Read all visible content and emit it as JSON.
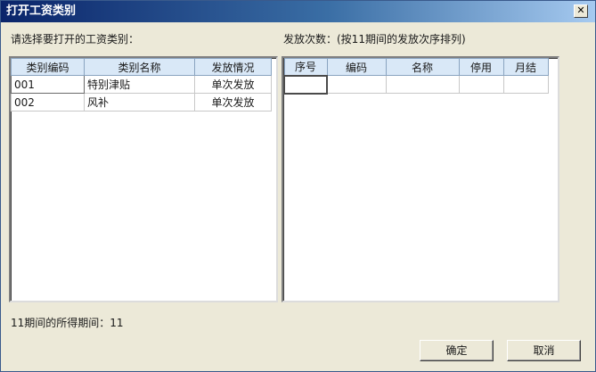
{
  "window": {
    "title": "打开工资类别",
    "close_glyph": "✕"
  },
  "left": {
    "label": "请选择要打开的工资类别：",
    "columns": [
      "类别编码",
      "类别名称",
      "发放情况"
    ],
    "rows": [
      [
        "001",
        "特别津贴",
        "单次发放"
      ],
      [
        "002",
        "风补",
        "单次发放"
      ]
    ]
  },
  "right": {
    "label": "发放次数：(按11期间的发放次序排列)",
    "columns": [
      "序号",
      "编码",
      "名称",
      "停用",
      "月结"
    ],
    "rows": [
      [
        "",
        "",
        "",
        "",
        ""
      ]
    ]
  },
  "status": {
    "text": "11期间的所得期间：11"
  },
  "buttons": {
    "ok": "确定",
    "cancel": "取消"
  }
}
